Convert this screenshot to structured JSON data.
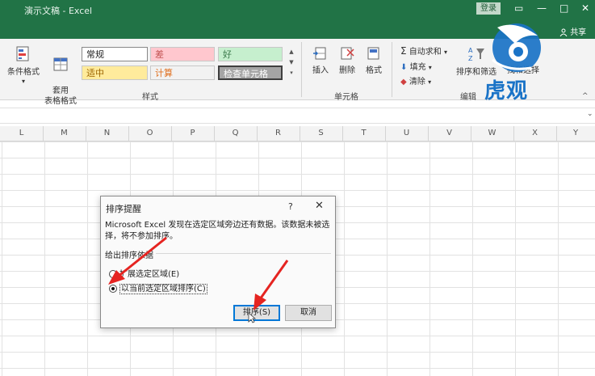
{
  "titlebar": {
    "title": "演示文稿 - Excel",
    "login": "登录",
    "share": "共享"
  },
  "window_controls": {
    "ribbon_options": "▭",
    "minimize": "—",
    "maximize": "□",
    "close": "✕"
  },
  "ribbon": {
    "styles": {
      "conditional_format": "条件格式",
      "format_as_table": "套用\n表格格式",
      "cells": [
        "常规",
        "差",
        "好",
        "适中",
        "计算",
        "检查单元格"
      ],
      "group_label": "样式"
    },
    "cells_group": {
      "insert": "插入",
      "delete": "删除",
      "format": "格式",
      "group_label": "单元格"
    },
    "editing": {
      "autosum": "自动求和",
      "fill": "填充",
      "clear": "清除",
      "sort_filter": "排序和筛选",
      "find_select": "找和选择",
      "group_label": "编辑"
    }
  },
  "columns": [
    "L",
    "M",
    "N",
    "O",
    "P",
    "Q",
    "R",
    "S",
    "T",
    "U",
    "V",
    "W",
    "X",
    "Y"
  ],
  "watermark": {
    "text": "虎观"
  },
  "dialog": {
    "title": "排序提醒",
    "help": "?",
    "close": "✕",
    "message": "Microsoft Excel 发现在选定区域旁边还有数据。该数据未被选择，将不参加排序。",
    "group_label": "给出排序依据",
    "options": [
      {
        "label": "扩展选定区域(E)",
        "selected": false
      },
      {
        "label": "以当前选定区域排序(C)",
        "selected": true
      }
    ],
    "sort_button": "排序(S)",
    "cancel_button": "取消"
  },
  "colors": {
    "excel_green": "#217346",
    "annotation_red": "#e52421",
    "watermark_blue": "#1a73c7"
  }
}
